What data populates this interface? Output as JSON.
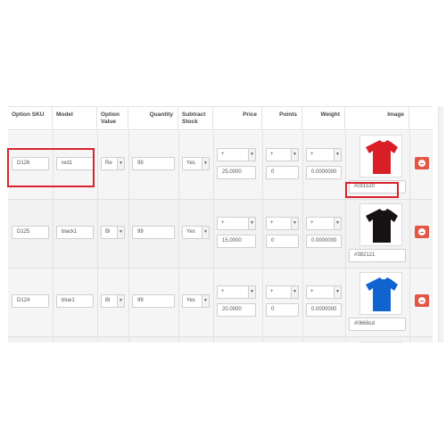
{
  "columns": {
    "option_sku": "Option SKU",
    "model": "Model",
    "option_value_1": "Option",
    "option_value_2": "Value",
    "quantity": "Quantity",
    "subtract_stock_1": "Subtract",
    "subtract_stock_2": "Stock",
    "price": "Price",
    "points": "Points",
    "weight": "Weight",
    "image": "Image"
  },
  "rows": [
    {
      "sku": "D126",
      "model": "red1",
      "option_value": "Re",
      "quantity": "99",
      "subtract": "Yes",
      "price_prefix": "+",
      "price": "25.0000",
      "points_prefix": "+",
      "points": "0",
      "weight_prefix": "+",
      "weight": "0.0000000",
      "color": "#c91520",
      "shirt_color": "#d91e26",
      "shirt_icon": "red-tshirt-icon"
    },
    {
      "sku": "D125",
      "model": "black1",
      "option_value": "Bl",
      "quantity": "99",
      "subtract": "Yes",
      "price_prefix": "+",
      "price": "15.0000",
      "points_prefix": "+",
      "points": "0",
      "weight_prefix": "+",
      "weight": "0.0000000",
      "color": "#382121",
      "shirt_color": "#161213",
      "shirt_icon": "black-tshirt-icon"
    },
    {
      "sku": "D124",
      "model": "blue1",
      "option_value": "Bl",
      "quantity": "99",
      "subtract": "Yes",
      "price_prefix": "+",
      "price": "20.0000",
      "points_prefix": "+",
      "points": "0",
      "weight_prefix": "+",
      "weight": "0.0000000",
      "color": "#0668cd",
      "shirt_color": "#1163d0",
      "shirt_icon": "blue-tshirt-icon"
    },
    {
      "shirt_color": "#2aa34a",
      "shirt_icon": "green-tshirt-icon"
    }
  ],
  "colors": {
    "highlight": "#d9232d",
    "remove_button": "#e35545"
  },
  "icons": {
    "remove": "minus-circle-icon",
    "dropdown": "chevron-down-icon"
  }
}
